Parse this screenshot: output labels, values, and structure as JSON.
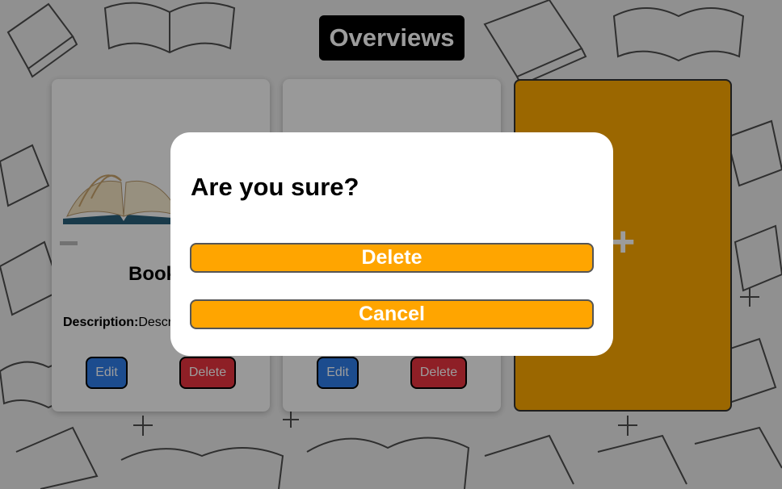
{
  "header": {
    "title": "Overviews"
  },
  "cards": [
    {
      "title": "Book",
      "description_label": "Description:",
      "description_value": "Descr",
      "edit_label": "Edit",
      "delete_label": "Delete"
    },
    {
      "edit_label": "Edit",
      "delete_label": "Delete"
    }
  ],
  "add_card": {
    "symbol": "+"
  },
  "modal": {
    "title": "Are you sure?",
    "delete_label": "Delete",
    "cancel_label": "Cancel"
  },
  "colors": {
    "accent": "#ffa500",
    "edit": "#2e7de9",
    "delete": "#e8343f"
  }
}
